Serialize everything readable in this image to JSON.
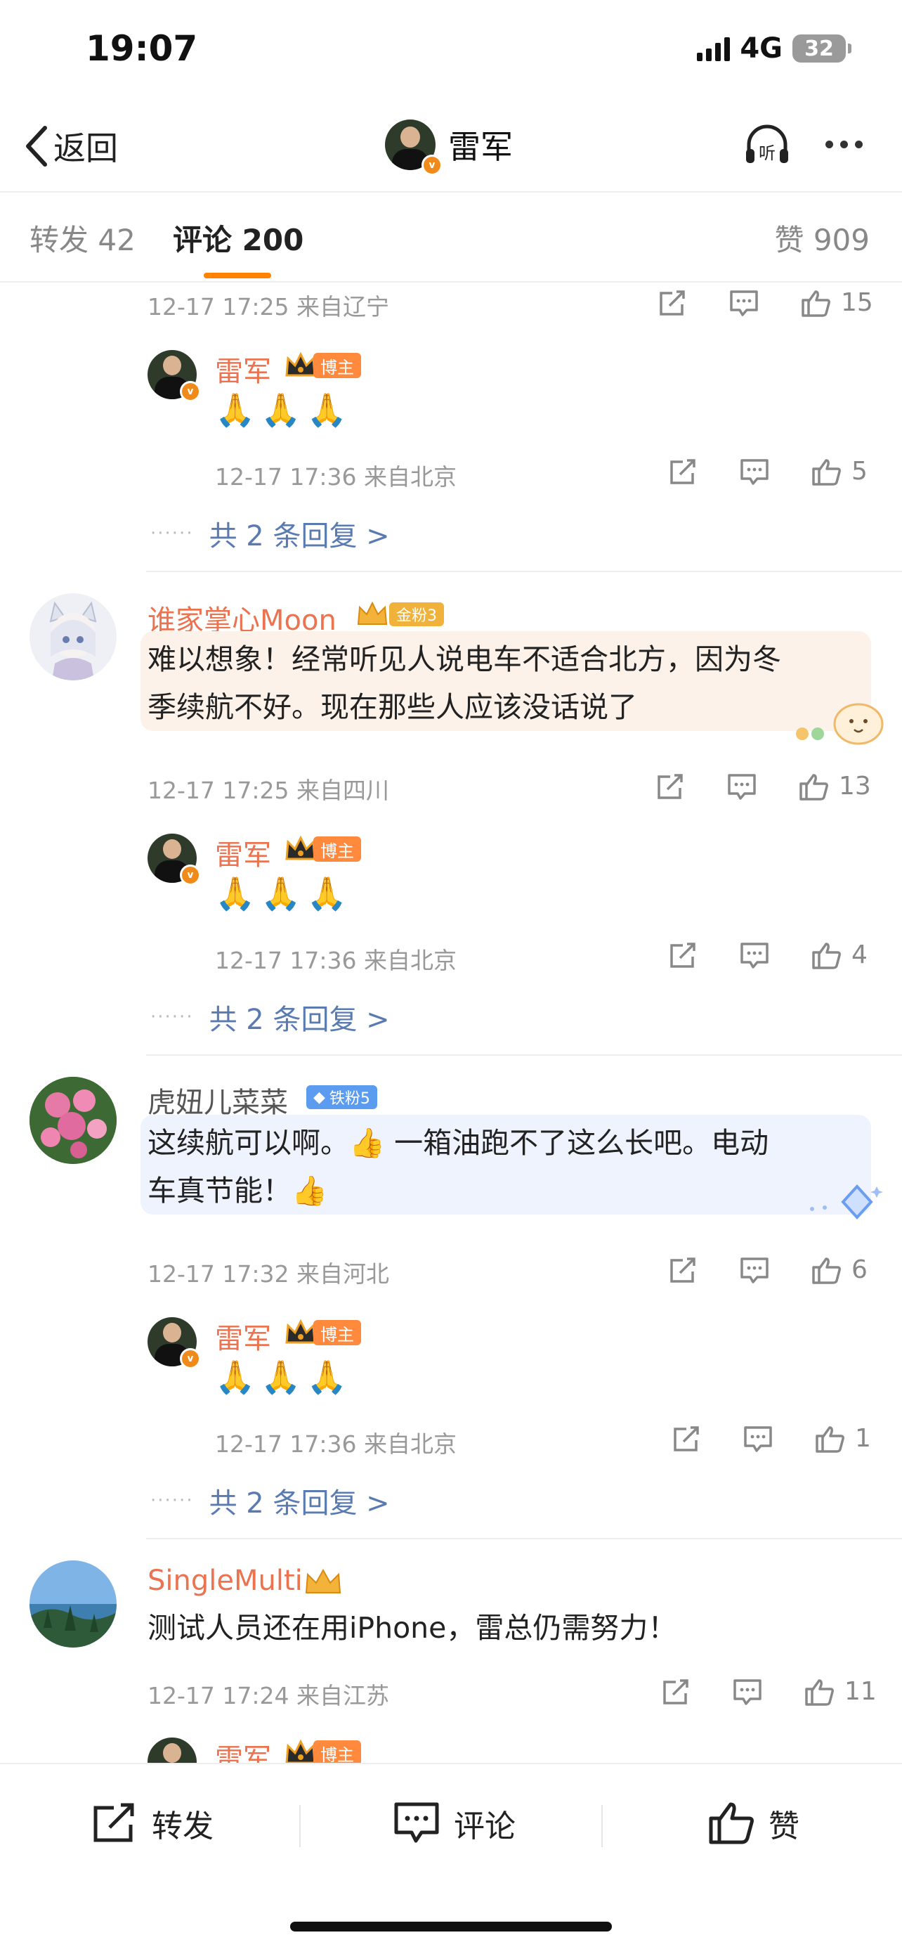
{
  "status_bar": {
    "time": "19:07",
    "network": "4G",
    "battery": "32"
  },
  "nav": {
    "back_label": "返回",
    "title": "雷军",
    "listen_label": "听"
  },
  "tabs": {
    "repost": "转发 42",
    "comments": "评论 200",
    "likes": "赞 909"
  },
  "comments": [
    {
      "meta": "12-17 17:25  来自辽宁",
      "likes": "15",
      "reply": {
        "name": "雷军",
        "badge": "博主",
        "emoji": "🙏🙏🙏",
        "meta": "12-17 17:36  来自北京",
        "likes": "5"
      },
      "more": "共 2 条回复 >"
    },
    {
      "name": "谁家掌心Moon",
      "fan_badge": "金粉3",
      "text_line1": "难以想象！经常听见人说电车不适合北方，因为冬",
      "text_line2": "季续航不好。现在那些人应该没话说了",
      "meta": "12-17 17:25  来自四川",
      "likes": "13",
      "reply": {
        "name": "雷军",
        "badge": "博主",
        "emoji": "🙏🙏🙏",
        "meta": "12-17 17:36  来自北京",
        "likes": "4"
      },
      "more": "共 2 条回复 >"
    },
    {
      "name": "虎妞儿菜菜",
      "fan_badge": "铁粉5",
      "text_line1": "这续航可以啊。👍 一箱油跑不了这么长吧。电动",
      "text_line2": "车真节能！👍",
      "meta": "12-17 17:32  来自河北",
      "likes": "6",
      "reply": {
        "name": "雷军",
        "badge": "博主",
        "emoji": "🙏🙏🙏",
        "meta": "12-17 17:36  来自北京",
        "likes": "1"
      },
      "more": "共 2 条回复 >"
    },
    {
      "name": "SingleMulti",
      "text_line1": "测试人员还在用iPhone，雷总仍需努力！",
      "meta": "12-17 17:24  来自江苏",
      "likes": "11",
      "reply": {
        "name": "雷军",
        "badge": "博主"
      }
    }
  ],
  "bottom_bar": {
    "repost": "转发",
    "comment": "评论",
    "like": "赞"
  },
  "colors": {
    "accent": "#ff8200",
    "name": "#eb7350",
    "link": "#5a7bb1"
  }
}
